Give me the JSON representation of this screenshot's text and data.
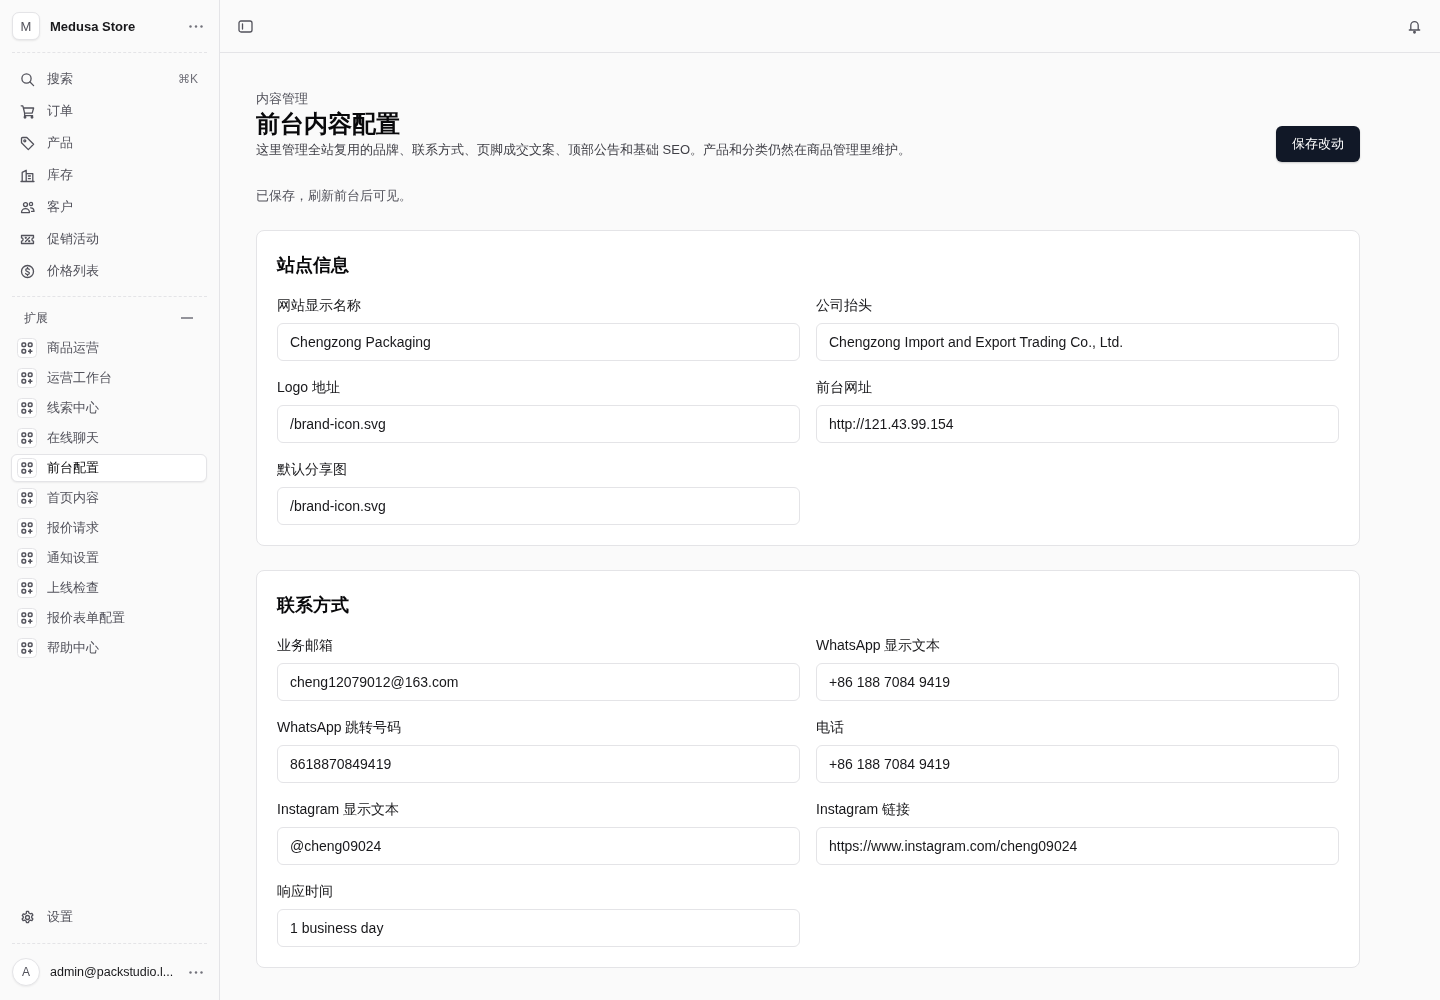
{
  "sidebar": {
    "store": {
      "initial": "M",
      "name": "Medusa Store"
    },
    "nav": [
      {
        "label": "搜索",
        "shortcut": "⌘K",
        "selected": false
      },
      {
        "label": "订单",
        "selected": false
      },
      {
        "label": "产品",
        "selected": false
      },
      {
        "label": "库存",
        "selected": false
      },
      {
        "label": "客户",
        "selected": false
      },
      {
        "label": "促销活动",
        "selected": false
      },
      {
        "label": "价格列表",
        "selected": false
      }
    ],
    "extensions": {
      "title": "扩展",
      "expanded": true,
      "items": [
        {
          "label": "商品运营",
          "selected": false
        },
        {
          "label": "运营工作台",
          "selected": false
        },
        {
          "label": "线索中心",
          "selected": false
        },
        {
          "label": "在线聊天",
          "selected": false
        },
        {
          "label": "前台配置",
          "selected": true
        },
        {
          "label": "首页内容",
          "selected": false
        },
        {
          "label": "报价请求",
          "selected": false
        },
        {
          "label": "通知设置",
          "selected": false
        },
        {
          "label": "上线检查",
          "selected": false
        },
        {
          "label": "报价表单配置",
          "selected": false
        },
        {
          "label": "帮助中心",
          "selected": false
        }
      ]
    },
    "settings": {
      "label": "设置",
      "selected": false
    },
    "user": {
      "initial": "A",
      "email": "admin@packstudio.l..."
    }
  },
  "page": {
    "breadcrumb": "内容管理",
    "title": "前台内容配置",
    "description": "这里管理全站复用的品牌、联系方式、页脚成交文案、顶部公告和基础 SEO。产品和分类仍然在商品管理里维护。",
    "save_button": "保存改动",
    "status": "已保存，刷新前台后可见。"
  },
  "sections": [
    {
      "title": "站点信息",
      "fields": [
        {
          "label": "网站显示名称",
          "value": "Chengzong Packaging"
        },
        {
          "label": "公司抬头",
          "value": "Chengzong Import and Export Trading Co., Ltd."
        },
        {
          "label": "Logo 地址",
          "value": "/brand-icon.svg"
        },
        {
          "label": "前台网址",
          "value": "http://121.43.99.154"
        },
        {
          "label": "默认分享图",
          "value": "/brand-icon.svg"
        }
      ]
    },
    {
      "title": "联系方式",
      "fields": [
        {
          "label": "业务邮箱",
          "value": "cheng12079012@163.com"
        },
        {
          "label": "WhatsApp 显示文本",
          "value": "+86 188 7084 9419"
        },
        {
          "label": "WhatsApp 跳转号码",
          "value": "8618870849419"
        },
        {
          "label": "电话",
          "value": "+86 188 7084 9419"
        },
        {
          "label": "Instagram 显示文本",
          "value": "@cheng09024"
        },
        {
          "label": "Instagram 链接",
          "value": "https://www.instagram.com/cheng09024"
        },
        {
          "label": "响应时间",
          "value": "1 business day"
        }
      ]
    }
  ]
}
